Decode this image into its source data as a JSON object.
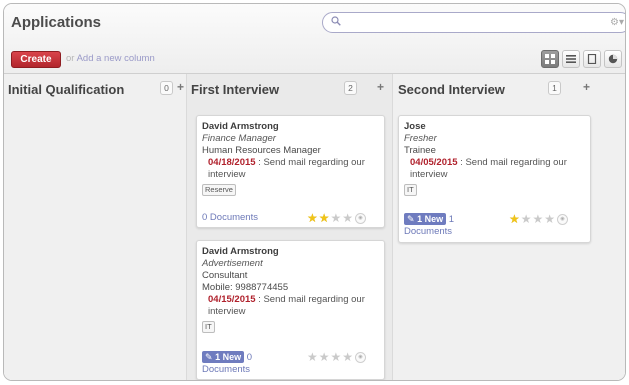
{
  "header": {
    "title": "Applications"
  },
  "search": {
    "value": "",
    "placeholder": "",
    "options_glyph": "⚙▾"
  },
  "toolbar": {
    "create_label": "Create",
    "or_label": "or",
    "add_column_label": "Add a new column"
  },
  "views": [
    {
      "icon": "kanban-icon",
      "active": true
    },
    {
      "icon": "list-icon",
      "active": false
    },
    {
      "icon": "form-icon",
      "active": false
    },
    {
      "icon": "graph-icon",
      "active": false
    },
    {
      "icon": "calendar-icon",
      "active": false
    }
  ],
  "columns": [
    {
      "title": "Initial Qualification",
      "count": "0",
      "plus": "+"
    },
    {
      "title": "First Interview",
      "count": "2",
      "plus": "+"
    },
    {
      "title": "Second Interview",
      "count": "1",
      "plus": "+"
    }
  ],
  "cards": {
    "first_1": {
      "name": "David Armstrong",
      "job": "Finance Manager",
      "position": "Human Resources Manager",
      "date": "04/18/2015",
      "sep": " : ",
      "message": "Send mail regarding our interview",
      "tag": "Reserve",
      "documents": "0 Documents",
      "stars_on": 2
    },
    "first_2": {
      "name": "David Armstrong",
      "job": "Advertisement",
      "position": "Consultant",
      "mobile": "Mobile: 9988774455",
      "date": "04/15/2015",
      "sep": " : ",
      "message": "Send mail regarding our interview",
      "tag": "IT",
      "new_badge": "1 New",
      "doc_count": "0",
      "documents": "Documents",
      "stars_on": 0
    },
    "second_1": {
      "name": "Jose",
      "job": "Fresher",
      "position": "Trainee",
      "date": "04/05/2015",
      "sep": " : ",
      "message": "Send mail regarding our interview",
      "tag": "IT",
      "new_badge": "1 New",
      "doc_count": "1",
      "documents": "Documents",
      "stars_on": 1
    }
  },
  "colors": {
    "accent": "#b0212c",
    "link": "#6d79b8",
    "star": "#f0c419",
    "create": "#c8323a"
  }
}
